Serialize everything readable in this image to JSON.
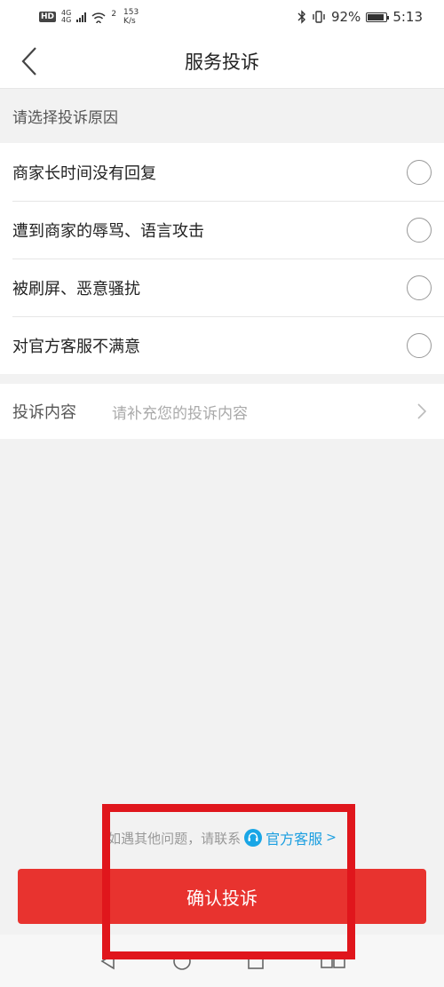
{
  "status_bar": {
    "hd_badge": "HD",
    "network": "4G",
    "network_sub": "4G",
    "hotspot_count": "2",
    "speed_value": "153",
    "speed_unit": "K/s",
    "battery": "92%",
    "time": "5:13"
  },
  "header": {
    "title": "服务投诉"
  },
  "reason_section": {
    "hint": "请选择投诉原因",
    "options": [
      {
        "label": "商家长时间没有回复"
      },
      {
        "label": "遭到商家的辱骂、语言攻击"
      },
      {
        "label": "被刷屏、恶意骚扰"
      },
      {
        "label": "对官方客服不满意"
      }
    ]
  },
  "content_row": {
    "label": "投诉内容",
    "placeholder": "请补充您的投诉内容"
  },
  "footer": {
    "contact_text": "如遇其他问题，请联系",
    "service_link": "官方客服",
    "confirm_label": "确认投诉"
  },
  "colors": {
    "accent": "#e8332f",
    "link": "#1a9ee0",
    "highlight": "#e0161c"
  },
  "icons": {
    "back": "chevron-left-icon",
    "chevron": "chevron-right-icon",
    "customer_service": "headset-icon"
  }
}
